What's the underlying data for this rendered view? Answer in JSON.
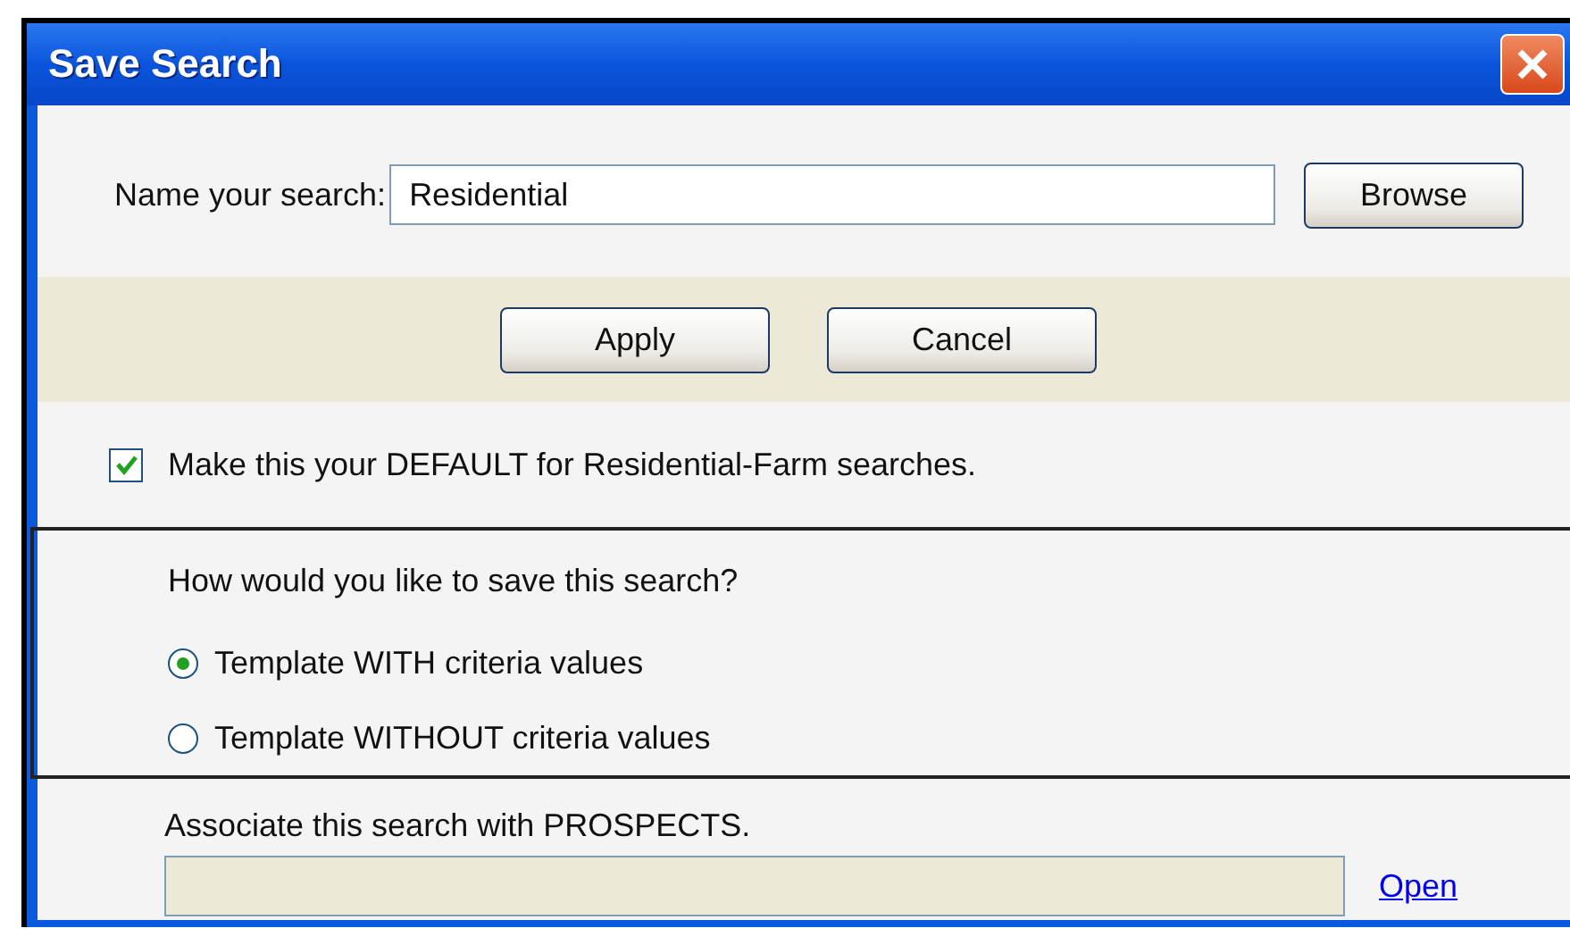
{
  "window": {
    "title": "Save Search"
  },
  "name_field": {
    "label": "Name your search:",
    "value": "Residential"
  },
  "browse_button": "Browse",
  "buttons": [
    "Apply",
    "Cancel"
  ],
  "default_option": {
    "label": "Make this your DEFAULT for Residential-Farm searches.",
    "checked": true
  },
  "save_mode": {
    "question": "How would you like to save this search?",
    "options": [
      {
        "label": "Template WITH criteria values",
        "selected": true
      },
      {
        "label": "Template WITHOUT criteria values",
        "selected": false
      }
    ]
  },
  "prospects": {
    "label": "Associate this search with PROSPECTS.",
    "disabled": true,
    "link": "Open"
  }
}
